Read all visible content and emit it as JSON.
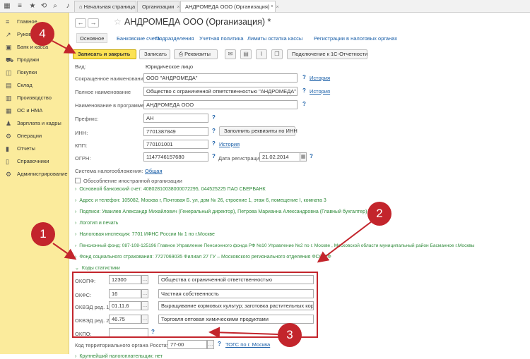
{
  "topbar": {
    "tabs": [
      {
        "label": "Начальная страница",
        "closable": false
      },
      {
        "label": "Организации",
        "closable": true
      },
      {
        "label": "АНДРОМЕДА ООО (Организация) *",
        "closable": true
      }
    ]
  },
  "sidebar": {
    "items": [
      {
        "label": "Главное",
        "icon": "list-icon"
      },
      {
        "label": "Руководителю",
        "icon": "chart-icon"
      },
      {
        "label": "Банк и касса",
        "icon": "bank-icon"
      },
      {
        "label": "Продажи",
        "icon": "cart-icon"
      },
      {
        "label": "Покупки",
        "icon": "basket-icon"
      },
      {
        "label": "Склад",
        "icon": "warehouse-icon"
      },
      {
        "label": "Производство",
        "icon": "factory-icon"
      },
      {
        "label": "ОС и НМА",
        "icon": "assets-icon"
      },
      {
        "label": "Зарплата и кадры",
        "icon": "people-icon"
      },
      {
        "label": "Операции",
        "icon": "operations-icon"
      },
      {
        "label": "Отчеты",
        "icon": "reports-icon"
      },
      {
        "label": "Справочники",
        "icon": "book-icon"
      },
      {
        "label": "Администрирование",
        "icon": "gear-icon"
      }
    ]
  },
  "form": {
    "title": "АНДРОМЕДА ООО (Организация) *",
    "subtabs": [
      "Основное",
      "Банковские счета",
      "Подразделения",
      "Учетная политика",
      "Лимиты остатка кассы",
      "Регистрации в налоговых органах"
    ],
    "toolbar": {
      "save_close": "Записать и закрыть",
      "save": "Записать",
      "requisites": "Реквизиты",
      "connect": "Подключение к 1С-Отчетности"
    },
    "vid_label": "Вид:",
    "vid_value": "Юридическое лицо",
    "short_name_label": "Сокращенное наименование:",
    "short_name": "ООО \"АНДРОМЕДА\"",
    "full_name_label": "Полное наименование",
    "full_name": "Общество с ограниченной ответственностью \"АНДРОМЕДА\"",
    "program_name_label": "Наименование в программе:",
    "program_name": "АНДРОМЕДА ООО",
    "history": "История",
    "prefix_label": "Префикс:",
    "prefix": "АН",
    "inn_label": "ИНН:",
    "inn": "7701387849",
    "fill_by_inn": "Заполнить реквизиты по ИНН",
    "kpp_label": "КПП:",
    "kpp": "770101001",
    "ogrn_label": "ОГРН:",
    "ogrn": "1147746157680",
    "reg_date_label": "Дата регистрации:",
    "reg_date": "21.02.2014",
    "tax_system_label": "Система налогообложения:",
    "tax_system": "Общая",
    "foreign_label": "Обособление иностранной организации",
    "groups": [
      "Основной банковский счет: 40802810038000072295, 044525225 ПАО СБЕРБАНК",
      "Адрес и телефон: 105082, Москва г, Почтовая Б. ул, дом № 26, строение 1, этаж 6, помещение I, комната 3",
      "Подписи: Уваилев Александр Михайлович (Генеральный директор), Петрова Марианна Александровна (Главный бухгалтер)",
      "Логотип и печать",
      "Налоговая инспекция: 7701 ИФНС России № 1 по г.Москве",
      "Пенсионный фонд: 087-108-125196 Главное Управление Пенсионного фонда РФ №10 Управление №2 по г. Москве , Московской области муниципальный район Басманное г.Москвы",
      "Фонд социального страхования: 7727069035 Филиал 27 ГУ – Московского регионального отделения ФСС РФ"
    ],
    "stat_codes_label": "Коды статистики",
    "codes": [
      {
        "label": "ОКОПФ:",
        "code": "12300",
        "text": "Общества с ограниченной ответственностью"
      },
      {
        "label": "ОКФС:",
        "code": "16",
        "text": "Частная собственность"
      },
      {
        "label": "ОКВЭД ред. 1:",
        "code": "01.11.6",
        "text": "Выращивание кормовых культур; заготовка растительных кормов"
      },
      {
        "label": "ОКВЭД ред. 2:",
        "code": "46.75",
        "text": "Торговля оптовая химическими продуктами"
      },
      {
        "label": "ОКПО:",
        "code": "",
        "text": ""
      }
    ],
    "rosstat_label": "Код территориального органа Росстата:",
    "rosstat_code": "77-00",
    "rosstat_link": "ТОГС по г. Москва",
    "largest_taxpayer": "Крупнейший налогоплательщик: нет"
  },
  "callouts": [
    "1",
    "2",
    "3",
    "4"
  ],
  "colors": {
    "sidebar": "#fbeb9c",
    "primary_button": "#fce254",
    "callout": "#c3252c",
    "link": "#1a5fa8",
    "group_link": "#2f8a3a"
  }
}
